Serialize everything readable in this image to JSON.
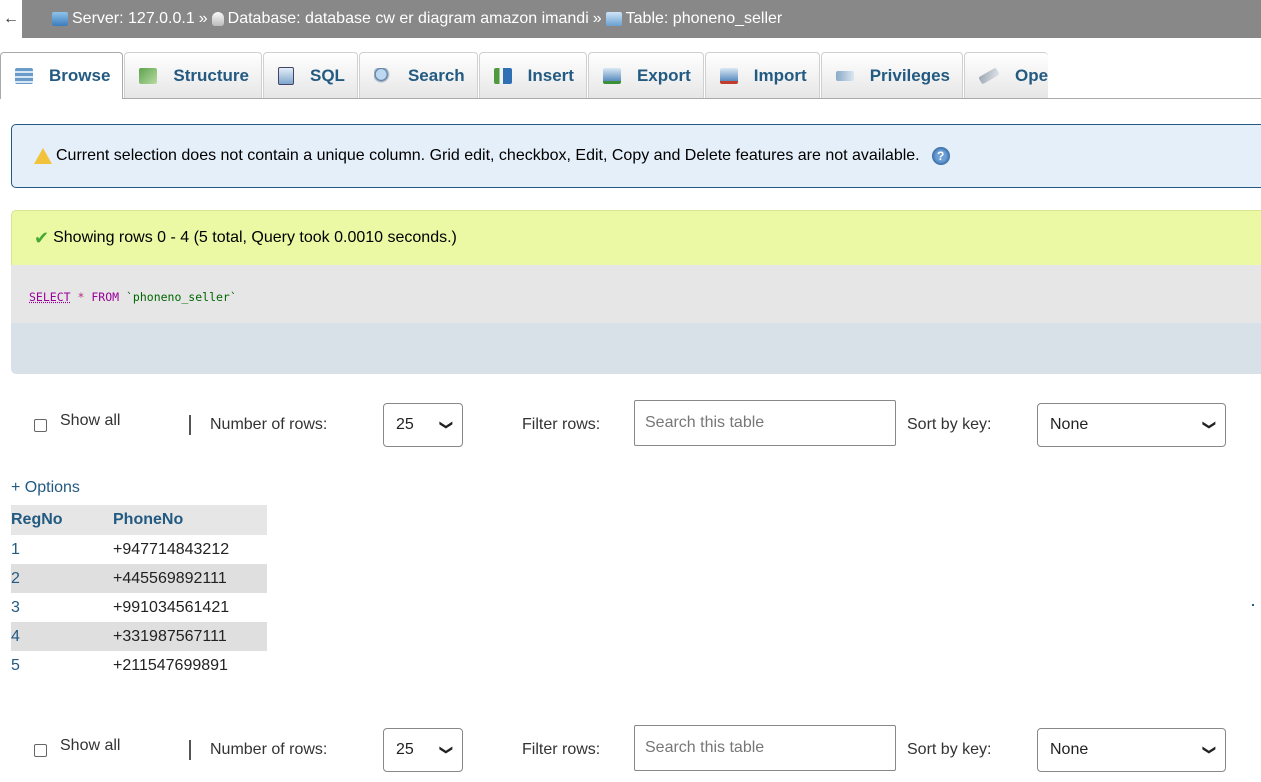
{
  "breadcrumb": {
    "back": "←",
    "server": "Server: 127.0.0.1",
    "sep1": "»",
    "database": "Database: database cw er diagram amazon imandi",
    "sep2": "»",
    "table": "Table: phoneno_seller"
  },
  "tabs": [
    {
      "label": "Browse",
      "icon": "browse-icon",
      "active": true
    },
    {
      "label": "Structure",
      "icon": "structure-icon"
    },
    {
      "label": "SQL",
      "icon": "sql-icon"
    },
    {
      "label": "Search",
      "icon": "search-icon"
    },
    {
      "label": "Insert",
      "icon": "insert-icon"
    },
    {
      "label": "Export",
      "icon": "export-icon"
    },
    {
      "label": "Import",
      "icon": "import-icon"
    },
    {
      "label": "Privileges",
      "icon": "privileges-icon"
    },
    {
      "label": "Ope",
      "icon": "operations-icon"
    }
  ],
  "notice": {
    "text": "Current selection does not contain a unique column. Grid edit, checkbox, Edit, Copy and Delete features are not available."
  },
  "success": {
    "text": "Showing rows 0 - 4 (5 total, Query took 0.0010 seconds.)"
  },
  "query": {
    "select": "SELECT",
    "star": "*",
    "from": "FROM",
    "table": "`phoneno_seller`"
  },
  "controls": {
    "show_all": "Show all",
    "number_of_rows_label": "Number of rows:",
    "number_of_rows_value": "25",
    "filter_label": "Filter rows:",
    "filter_placeholder": "Search this table",
    "sort_label": "Sort by key:",
    "sort_value": "None"
  },
  "options_link": "+ Options",
  "table": {
    "columns": [
      "RegNo",
      "PhoneNo"
    ],
    "rows": [
      [
        "1",
        "+947714843212"
      ],
      [
        "2",
        "+445569892111"
      ],
      [
        "3",
        "+991034561421"
      ],
      [
        "4",
        "+331987567111"
      ],
      [
        "5",
        "+211547699891"
      ]
    ]
  },
  "colors": {
    "link": "#235a81",
    "success_bg": "#ebf8a4",
    "notice_bg": "#e5effa",
    "topbar_bg": "#888888"
  }
}
